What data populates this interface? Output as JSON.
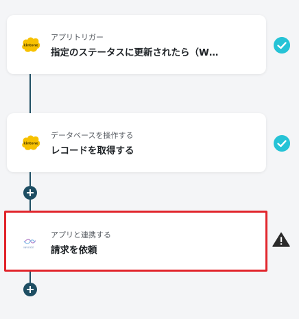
{
  "steps": [
    {
      "subtitle": "アプリトリガー",
      "title": "指定のステータスに更新されたら（W…",
      "logo_text": "kintone",
      "status": "completed",
      "status_icon": "check-circle-icon"
    },
    {
      "subtitle": "データベースを操作する",
      "title": "レコードを取得する",
      "logo_text": "kintone",
      "status": "completed",
      "status_icon": "check-circle-icon"
    },
    {
      "subtitle": "アプリと連携する",
      "title": "請求を依頼",
      "logo_text": "INVOICE",
      "status": "warning",
      "status_icon": "warning-triangle-icon"
    }
  ],
  "colors": {
    "connector": "#1e4e63",
    "check": "#26c3d6",
    "highlight_border": "#e1242b",
    "kintone_logo": "#f7c100",
    "warning": "#2b2b2b"
  }
}
